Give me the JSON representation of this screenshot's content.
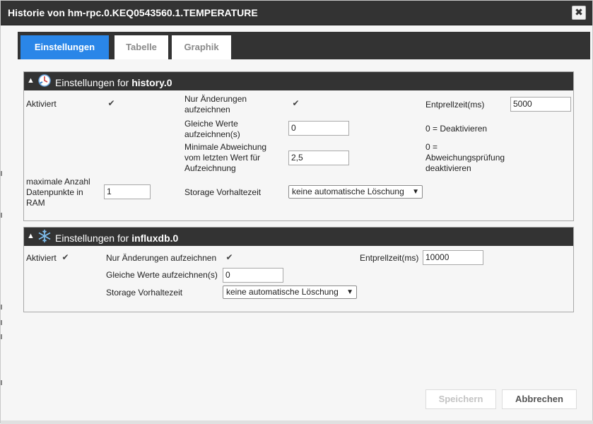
{
  "dialog": {
    "title": "Historie von hm-rpc.0.KEQ0543560.1.TEMPERATURE",
    "close_icon": "close-icon"
  },
  "tabs": [
    {
      "label": "Einstellungen",
      "active": true
    },
    {
      "label": "Tabelle",
      "active": false
    },
    {
      "label": "Graphik",
      "active": false
    }
  ],
  "history": {
    "header_prefix": "Einstellungen for",
    "header_name": "history.0",
    "icon": "clock-icon",
    "enabled_label": "Aktiviert",
    "enabled_value": "✔",
    "changes_label_1": "Nur Änderungen",
    "changes_label_2": "aufzeichnen",
    "changes_value": "✔",
    "debounce_label": "Entprellzeit(ms)",
    "debounce_value": "5000",
    "same_label_1": "Gleiche Werte",
    "same_label_2": "aufzeichnen(s)",
    "same_value": "0",
    "same_hint": "0 = Deaktivieren",
    "mindev_label_1": "Minimale Abweichung",
    "mindev_label_2": "vom letzten Wert für",
    "mindev_label_3": "Aufzeichnung",
    "mindev_value": "2,5",
    "mindev_hint_1": "0 =",
    "mindev_hint_2": "Abweichungsprüfung",
    "mindev_hint_3": "deaktivieren",
    "maxpoints_label_1": "maximale Anzahl",
    "maxpoints_label_2": "Datenpunkte in",
    "maxpoints_label_3": "RAM",
    "maxpoints_value": "1",
    "storage_label": "Storage Vorhaltezeit",
    "storage_value": "keine automatische Löschung"
  },
  "influx": {
    "header_prefix": "Einstellungen for",
    "header_name": "influxdb.0",
    "icon": "snowflake-icon",
    "enabled_label": "Aktiviert",
    "enabled_value": "✔",
    "changes_label": "Nur Änderungen aufzeichnen",
    "changes_value": "✔",
    "debounce_label": "Entprellzeit(ms)",
    "debounce_value": "10000",
    "same_label": "Gleiche Werte aufzeichnen(s)",
    "same_value": "0",
    "storage_label": "Storage Vorhaltezeit",
    "storage_value": "keine automatische Löschung"
  },
  "footer": {
    "save_label": "Speichern",
    "cancel_label": "Abbrechen"
  },
  "colors": {
    "header_bg": "#333333",
    "tab_active": "#2a86e8"
  }
}
